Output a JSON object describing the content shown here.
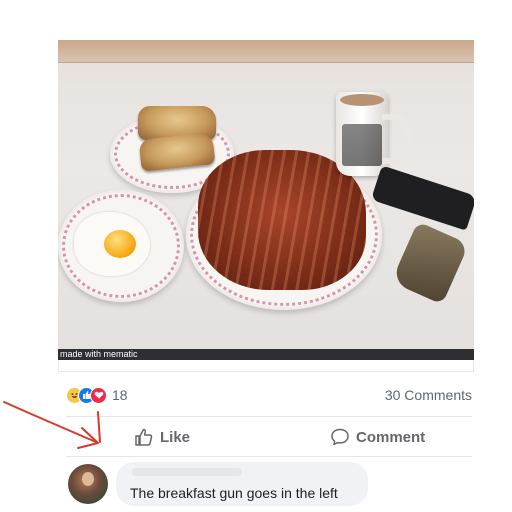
{
  "photo": {
    "watermark": "made with mematic"
  },
  "reactions": {
    "icons": [
      "haha-icon",
      "like-icon",
      "love-icon"
    ],
    "count": "18"
  },
  "comments": {
    "count_label": "30 Comments"
  },
  "actions": {
    "like_label": "Like",
    "comment_label": "Comment"
  },
  "comment": {
    "text": "The breakfast gun goes in the left"
  },
  "colors": {
    "like_blue": "#1877f2",
    "love_red": "#f02849",
    "haha_yellow": "#f7c845",
    "annotation_red": "#d83a2a",
    "meta_gray": "#606770"
  }
}
